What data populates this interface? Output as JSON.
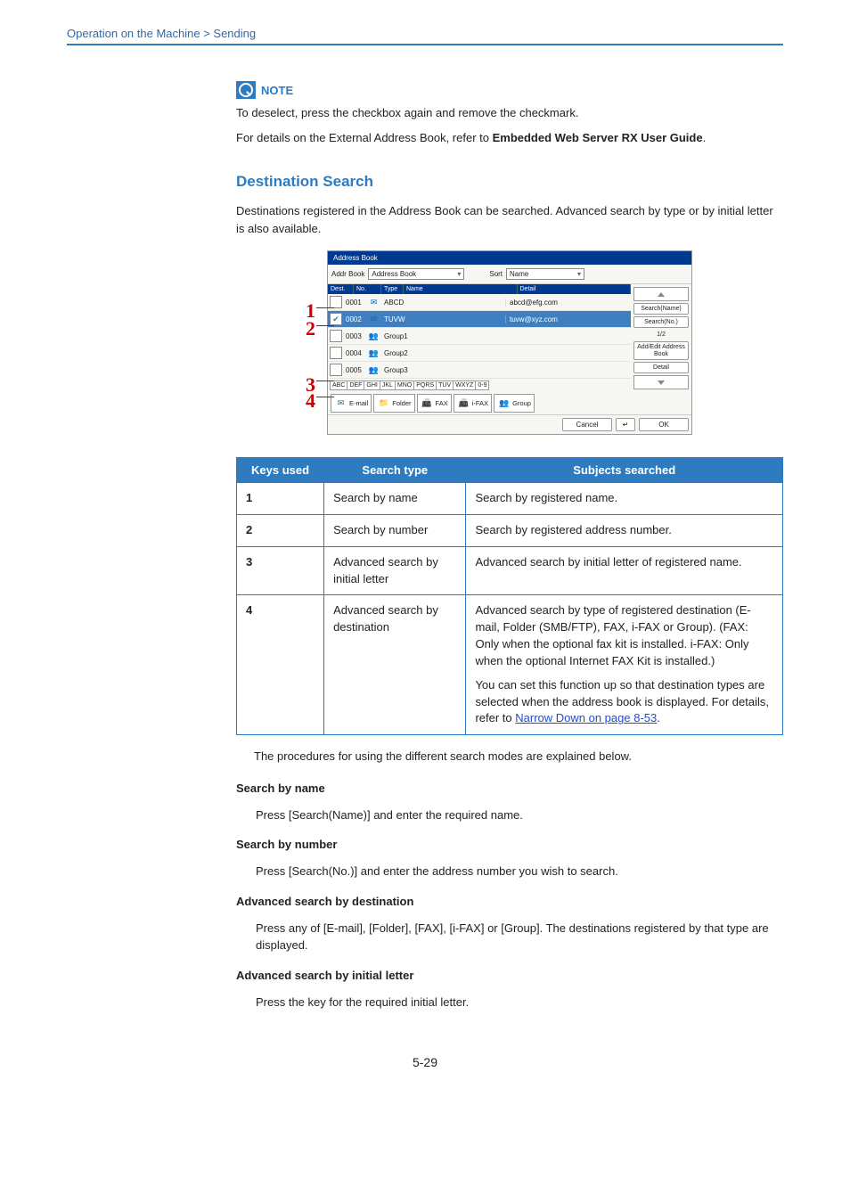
{
  "breadcrumb": "Operation on the Machine > Sending",
  "note": {
    "label": "NOTE",
    "line1": "To deselect, press the checkbox again and remove the checkmark.",
    "line2a": "For details on the External Address Book, refer to ",
    "line2b": "Embedded Web Server RX User Guide",
    "line2c": "."
  },
  "section_title": "Destination Search",
  "intro": "Destinations registered in the Address Book can be searched. Advanced search by type or by initial letter is also available.",
  "callouts": {
    "c1": "1",
    "c2": "2",
    "c3": "3",
    "c4": "4"
  },
  "mock": {
    "title": "Address Book",
    "addr_label": "Addr Book",
    "addr_value": "Address Book",
    "sort_label": "Sort",
    "sort_value": "Name",
    "head": {
      "dest": "Dest.",
      "no": "No.",
      "type": "Type",
      "name": "Name",
      "detail": "Detail"
    },
    "rows": [
      {
        "no": "0001",
        "name": "ABCD",
        "detail": "abcd@efg.com",
        "sel": false,
        "type": "mail"
      },
      {
        "no": "0002",
        "name": "TUVW",
        "detail": "tuvw@xyz.com",
        "sel": true,
        "type": "mail"
      },
      {
        "no": "0003",
        "name": "Group1",
        "detail": "",
        "sel": false,
        "type": "grp"
      },
      {
        "no": "0004",
        "name": "Group2",
        "detail": "",
        "sel": false,
        "type": "grp"
      },
      {
        "no": "0005",
        "name": "Group3",
        "detail": "",
        "sel": false,
        "type": "grp"
      }
    ],
    "page_ind": "1/2",
    "side": {
      "search_name": "Search(Name)",
      "search_no": "Search(No.)",
      "add_edit": "Add/Edit Address Book",
      "detail": "Detail"
    },
    "letters": [
      "ABC",
      "DEF",
      "GHI",
      "JKL",
      "MNO",
      "PQRS",
      "TUV",
      "WXYZ",
      "0-9"
    ],
    "filters": {
      "email": "E-mail",
      "folder": "Folder",
      "fax": "FAX",
      "ifax": "i-FAX",
      "group": "Group"
    },
    "cancel": "Cancel",
    "ok": "OK",
    "enter_sym": "↵"
  },
  "table": {
    "h1": "Keys used",
    "h2": "Search type",
    "h3": "Subjects searched",
    "rows": [
      {
        "k": "1",
        "st": "Search by name",
        "ss": "Search by registered name."
      },
      {
        "k": "2",
        "st": "Search by number",
        "ss": "Search by registered address number."
      },
      {
        "k": "3",
        "st": "Advanced search by initial letter",
        "ss": "Advanced search by initial letter of registered name."
      },
      {
        "k": "4",
        "st": "Advanced search by destination",
        "ss": "Advanced search by type of registered destination (E-mail, Folder (SMB/FTP), FAX, i-FAX or Group). (FAX: Only when the optional fax kit is installed. i-FAX: Only when the optional Internet FAX Kit is installed.)",
        "ss2a": "You can set this function up so that destination types are selected when the address book is displayed. For details, refer to ",
        "ss2_link": "Narrow Down on page 8-53",
        "ss2b": "."
      }
    ]
  },
  "procedures_intro": "The procedures for using the different search modes are explained below.",
  "sections": {
    "s1": {
      "title": "Search by name",
      "body": "Press [Search(Name)] and enter the required name."
    },
    "s2": {
      "title": "Search by number",
      "body": "Press [Search(No.)] and enter the address number you wish to search."
    },
    "s3": {
      "title": "Advanced search by destination",
      "body": "Press any of [E-mail], [Folder], [FAX], [i-FAX] or [Group]. The destinations registered by that type are displayed."
    },
    "s4": {
      "title": "Advanced search by initial letter",
      "body": "Press the key for the required initial letter."
    }
  },
  "page_num": "5-29"
}
